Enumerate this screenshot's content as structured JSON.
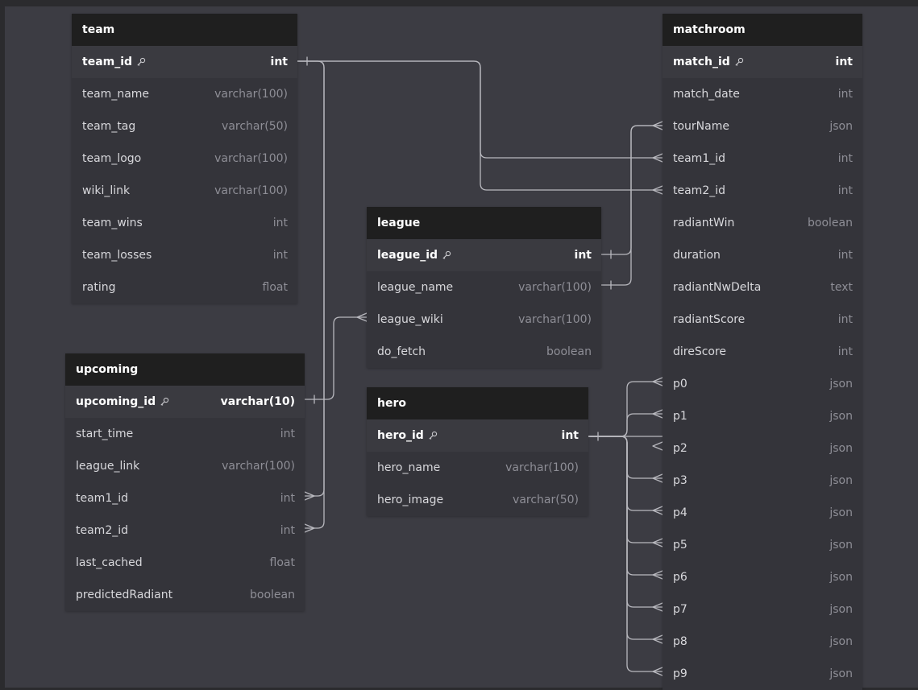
{
  "tables": {
    "team": {
      "title": "team",
      "columns": [
        {
          "name": "team_id",
          "type": "int",
          "pk": true
        },
        {
          "name": "team_name",
          "type": "varchar(100)"
        },
        {
          "name": "team_tag",
          "type": "varchar(50)"
        },
        {
          "name": "team_logo",
          "type": "varchar(100)"
        },
        {
          "name": "wiki_link",
          "type": "varchar(100)"
        },
        {
          "name": "team_wins",
          "type": "int"
        },
        {
          "name": "team_losses",
          "type": "int"
        },
        {
          "name": "rating",
          "type": "float"
        }
      ]
    },
    "upcoming": {
      "title": "upcoming",
      "columns": [
        {
          "name": "upcoming_id",
          "type": "varchar(10)",
          "pk": true
        },
        {
          "name": "start_time",
          "type": "int"
        },
        {
          "name": "league_link",
          "type": "varchar(100)"
        },
        {
          "name": "team1_id",
          "type": "int"
        },
        {
          "name": "team2_id",
          "type": "int"
        },
        {
          "name": "last_cached",
          "type": "float"
        },
        {
          "name": "predictedRadiant",
          "type": "boolean"
        }
      ]
    },
    "league": {
      "title": "league",
      "columns": [
        {
          "name": "league_id",
          "type": "int",
          "pk": true
        },
        {
          "name": "league_name",
          "type": "varchar(100)"
        },
        {
          "name": "league_wiki",
          "type": "varchar(100)"
        },
        {
          "name": "do_fetch",
          "type": "boolean"
        }
      ]
    },
    "hero": {
      "title": "hero",
      "columns": [
        {
          "name": "hero_id",
          "type": "int",
          "pk": true
        },
        {
          "name": "hero_name",
          "type": "varchar(100)"
        },
        {
          "name": "hero_image",
          "type": "varchar(50)"
        }
      ]
    },
    "matchroom": {
      "title": "matchroom",
      "columns": [
        {
          "name": "match_id",
          "type": "int",
          "pk": true
        },
        {
          "name": "match_date",
          "type": "int"
        },
        {
          "name": "tourName",
          "type": "json"
        },
        {
          "name": "team1_id",
          "type": "int"
        },
        {
          "name": "team2_id",
          "type": "int"
        },
        {
          "name": "radiantWin",
          "type": "boolean"
        },
        {
          "name": "duration",
          "type": "int"
        },
        {
          "name": "radiantNwDelta",
          "type": "text"
        },
        {
          "name": "radiantScore",
          "type": "int"
        },
        {
          "name": "direScore",
          "type": "int"
        },
        {
          "name": "p0",
          "type": "json"
        },
        {
          "name": "p1",
          "type": "json"
        },
        {
          "name": "p2",
          "type": "json"
        },
        {
          "name": "p3",
          "type": "json"
        },
        {
          "name": "p4",
          "type": "json"
        },
        {
          "name": "p5",
          "type": "json"
        },
        {
          "name": "p6",
          "type": "json"
        },
        {
          "name": "p7",
          "type": "json"
        },
        {
          "name": "p8",
          "type": "json"
        },
        {
          "name": "p9",
          "type": "json"
        }
      ]
    }
  },
  "icons": {
    "primary_key": "key-icon"
  },
  "colors": {
    "background": "#3c3c43",
    "table_header": "#1f1f1f",
    "table_body": "#34343a",
    "connector": "#b8b8be"
  }
}
